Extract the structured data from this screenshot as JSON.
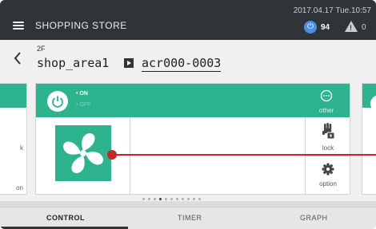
{
  "status_bar": {
    "datetime": "2017.04.17 Tue.10:57",
    "power_count": "94",
    "warning_count": "0"
  },
  "header": {
    "menu_icon": "hamburger-menu-icon",
    "app_title": "SHOPPING STORE",
    "floor": "2F",
    "area_name": "shop_area1",
    "device_id": "acr000-0003"
  },
  "left_card": {
    "label_1": "k",
    "label_2": "on"
  },
  "card": {
    "on_label": "• ON",
    "off_label": "• OFF",
    "other_label": "other",
    "lock_label": "lock",
    "option_label": "option",
    "accent_color": "#2db38e"
  },
  "carousel": {
    "page_count": 11,
    "active_page": 4
  },
  "tabs": {
    "control": "CONTROL",
    "timer": "TIMER",
    "graph": "GRAPH"
  }
}
